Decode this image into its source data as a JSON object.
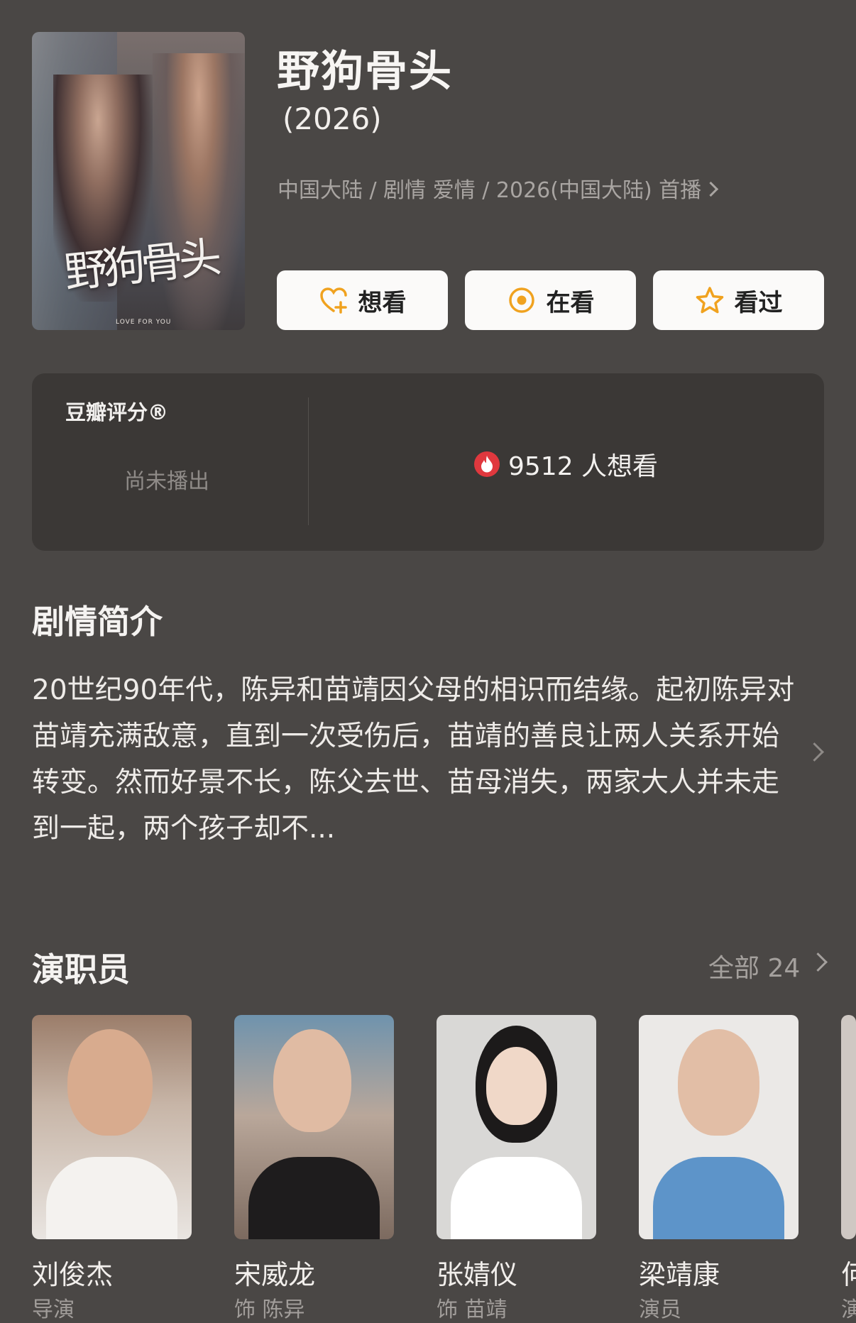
{
  "movie": {
    "title": "野狗骨头",
    "year": "(2026)",
    "meta": "中国大陆 / 剧情 爱情 / 2026(中国大陆) 首播",
    "poster": {
      "script_title": "野狗骨头",
      "tagline": "LOVE FOR YOU"
    }
  },
  "actions": [
    {
      "label": "想看",
      "icon": "heart-plus-icon"
    },
    {
      "label": "在看",
      "icon": "circle-dot-icon"
    },
    {
      "label": "看过",
      "icon": "star-icon"
    }
  ],
  "rating": {
    "label": "豆瓣评分®",
    "status": "尚未播出",
    "want_count": "9512 人想看"
  },
  "synopsis": {
    "heading": "剧情简介",
    "text": "20世纪90年代，陈异和苗靖因父母的相识而结缘。起初陈异对苗靖充满敌意，直到一次受伤后，苗靖的善良让两人关系开始转变。然而好景不长，陈父去世、苗母消失，两家大人并未走到一起，两个孩子却不..."
  },
  "cast": {
    "heading": "演职员",
    "all_label": "全部 24",
    "members": [
      {
        "name": "刘俊杰",
        "role": "导演"
      },
      {
        "name": "宋威龙",
        "role": "饰 陈异"
      },
      {
        "name": "张婧仪",
        "role": "饰 苗靖"
      },
      {
        "name": "梁靖康",
        "role": "演员"
      },
      {
        "name": "何",
        "role": "演"
      }
    ]
  },
  "colors": {
    "background": "#4a4745",
    "card": "#3b3836",
    "accent": "#f0a21f",
    "fire": "#e0383e"
  }
}
